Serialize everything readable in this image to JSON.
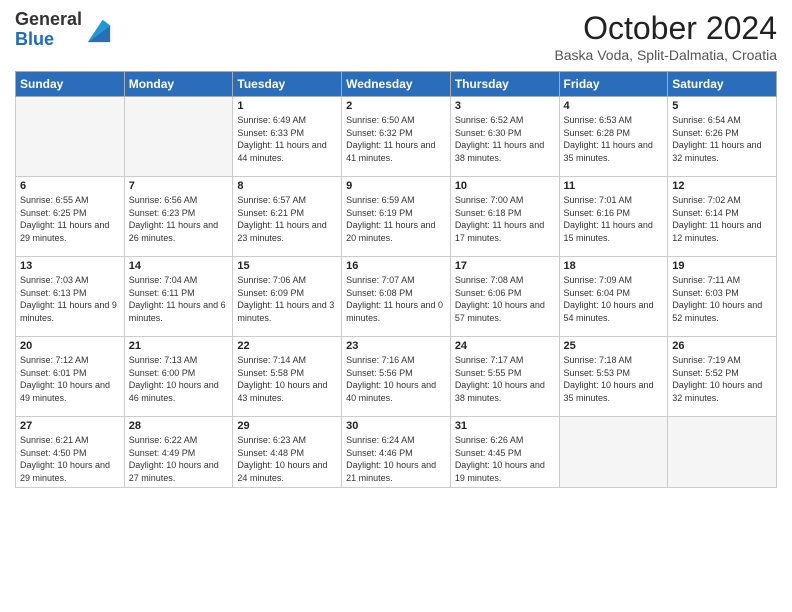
{
  "header": {
    "logo_line1": "General",
    "logo_line2": "Blue",
    "month_title": "October 2024",
    "subtitle": "Baska Voda, Split-Dalmatia, Croatia"
  },
  "days_of_week": [
    "Sunday",
    "Monday",
    "Tuesday",
    "Wednesday",
    "Thursday",
    "Friday",
    "Saturday"
  ],
  "weeks": [
    [
      {
        "day": "",
        "sunrise": "",
        "sunset": "",
        "daylight": ""
      },
      {
        "day": "",
        "sunrise": "",
        "sunset": "",
        "daylight": ""
      },
      {
        "day": "1",
        "sunrise": "Sunrise: 6:49 AM",
        "sunset": "Sunset: 6:33 PM",
        "daylight": "Daylight: 11 hours and 44 minutes."
      },
      {
        "day": "2",
        "sunrise": "Sunrise: 6:50 AM",
        "sunset": "Sunset: 6:32 PM",
        "daylight": "Daylight: 11 hours and 41 minutes."
      },
      {
        "day": "3",
        "sunrise": "Sunrise: 6:52 AM",
        "sunset": "Sunset: 6:30 PM",
        "daylight": "Daylight: 11 hours and 38 minutes."
      },
      {
        "day": "4",
        "sunrise": "Sunrise: 6:53 AM",
        "sunset": "Sunset: 6:28 PM",
        "daylight": "Daylight: 11 hours and 35 minutes."
      },
      {
        "day": "5",
        "sunrise": "Sunrise: 6:54 AM",
        "sunset": "Sunset: 6:26 PM",
        "daylight": "Daylight: 11 hours and 32 minutes."
      }
    ],
    [
      {
        "day": "6",
        "sunrise": "Sunrise: 6:55 AM",
        "sunset": "Sunset: 6:25 PM",
        "daylight": "Daylight: 11 hours and 29 minutes."
      },
      {
        "day": "7",
        "sunrise": "Sunrise: 6:56 AM",
        "sunset": "Sunset: 6:23 PM",
        "daylight": "Daylight: 11 hours and 26 minutes."
      },
      {
        "day": "8",
        "sunrise": "Sunrise: 6:57 AM",
        "sunset": "Sunset: 6:21 PM",
        "daylight": "Daylight: 11 hours and 23 minutes."
      },
      {
        "day": "9",
        "sunrise": "Sunrise: 6:59 AM",
        "sunset": "Sunset: 6:19 PM",
        "daylight": "Daylight: 11 hours and 20 minutes."
      },
      {
        "day": "10",
        "sunrise": "Sunrise: 7:00 AM",
        "sunset": "Sunset: 6:18 PM",
        "daylight": "Daylight: 11 hours and 17 minutes."
      },
      {
        "day": "11",
        "sunrise": "Sunrise: 7:01 AM",
        "sunset": "Sunset: 6:16 PM",
        "daylight": "Daylight: 11 hours and 15 minutes."
      },
      {
        "day": "12",
        "sunrise": "Sunrise: 7:02 AM",
        "sunset": "Sunset: 6:14 PM",
        "daylight": "Daylight: 11 hours and 12 minutes."
      }
    ],
    [
      {
        "day": "13",
        "sunrise": "Sunrise: 7:03 AM",
        "sunset": "Sunset: 6:13 PM",
        "daylight": "Daylight: 11 hours and 9 minutes."
      },
      {
        "day": "14",
        "sunrise": "Sunrise: 7:04 AM",
        "sunset": "Sunset: 6:11 PM",
        "daylight": "Daylight: 11 hours and 6 minutes."
      },
      {
        "day": "15",
        "sunrise": "Sunrise: 7:06 AM",
        "sunset": "Sunset: 6:09 PM",
        "daylight": "Daylight: 11 hours and 3 minutes."
      },
      {
        "day": "16",
        "sunrise": "Sunrise: 7:07 AM",
        "sunset": "Sunset: 6:08 PM",
        "daylight": "Daylight: 11 hours and 0 minutes."
      },
      {
        "day": "17",
        "sunrise": "Sunrise: 7:08 AM",
        "sunset": "Sunset: 6:06 PM",
        "daylight": "Daylight: 10 hours and 57 minutes."
      },
      {
        "day": "18",
        "sunrise": "Sunrise: 7:09 AM",
        "sunset": "Sunset: 6:04 PM",
        "daylight": "Daylight: 10 hours and 54 minutes."
      },
      {
        "day": "19",
        "sunrise": "Sunrise: 7:11 AM",
        "sunset": "Sunset: 6:03 PM",
        "daylight": "Daylight: 10 hours and 52 minutes."
      }
    ],
    [
      {
        "day": "20",
        "sunrise": "Sunrise: 7:12 AM",
        "sunset": "Sunset: 6:01 PM",
        "daylight": "Daylight: 10 hours and 49 minutes."
      },
      {
        "day": "21",
        "sunrise": "Sunrise: 7:13 AM",
        "sunset": "Sunset: 6:00 PM",
        "daylight": "Daylight: 10 hours and 46 minutes."
      },
      {
        "day": "22",
        "sunrise": "Sunrise: 7:14 AM",
        "sunset": "Sunset: 5:58 PM",
        "daylight": "Daylight: 10 hours and 43 minutes."
      },
      {
        "day": "23",
        "sunrise": "Sunrise: 7:16 AM",
        "sunset": "Sunset: 5:56 PM",
        "daylight": "Daylight: 10 hours and 40 minutes."
      },
      {
        "day": "24",
        "sunrise": "Sunrise: 7:17 AM",
        "sunset": "Sunset: 5:55 PM",
        "daylight": "Daylight: 10 hours and 38 minutes."
      },
      {
        "day": "25",
        "sunrise": "Sunrise: 7:18 AM",
        "sunset": "Sunset: 5:53 PM",
        "daylight": "Daylight: 10 hours and 35 minutes."
      },
      {
        "day": "26",
        "sunrise": "Sunrise: 7:19 AM",
        "sunset": "Sunset: 5:52 PM",
        "daylight": "Daylight: 10 hours and 32 minutes."
      }
    ],
    [
      {
        "day": "27",
        "sunrise": "Sunrise: 6:21 AM",
        "sunset": "Sunset: 4:50 PM",
        "daylight": "Daylight: 10 hours and 29 minutes."
      },
      {
        "day": "28",
        "sunrise": "Sunrise: 6:22 AM",
        "sunset": "Sunset: 4:49 PM",
        "daylight": "Daylight: 10 hours and 27 minutes."
      },
      {
        "day": "29",
        "sunrise": "Sunrise: 6:23 AM",
        "sunset": "Sunset: 4:48 PM",
        "daylight": "Daylight: 10 hours and 24 minutes."
      },
      {
        "day": "30",
        "sunrise": "Sunrise: 6:24 AM",
        "sunset": "Sunset: 4:46 PM",
        "daylight": "Daylight: 10 hours and 21 minutes."
      },
      {
        "day": "31",
        "sunrise": "Sunrise: 6:26 AM",
        "sunset": "Sunset: 4:45 PM",
        "daylight": "Daylight: 10 hours and 19 minutes."
      },
      {
        "day": "",
        "sunrise": "",
        "sunset": "",
        "daylight": ""
      },
      {
        "day": "",
        "sunrise": "",
        "sunset": "",
        "daylight": ""
      }
    ]
  ]
}
